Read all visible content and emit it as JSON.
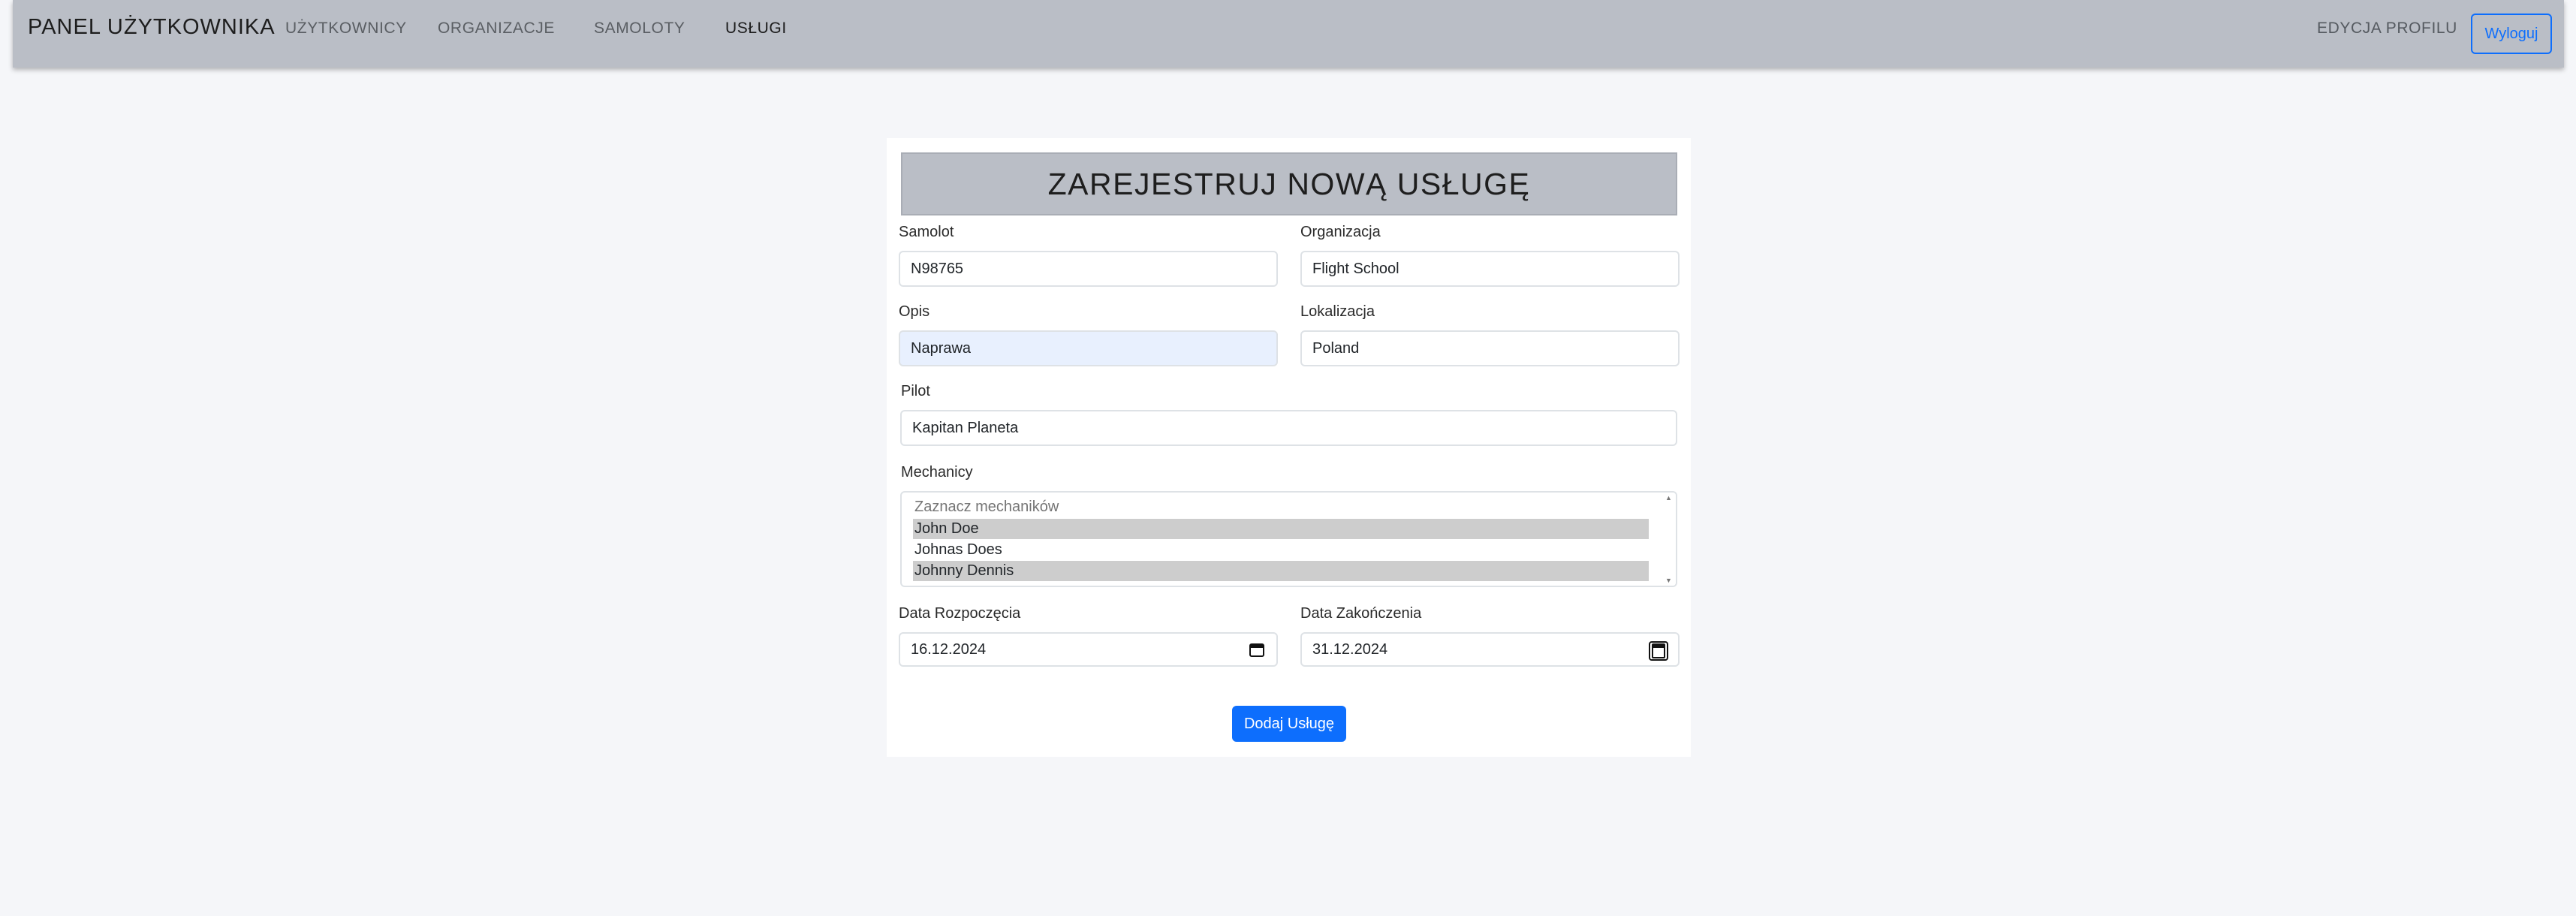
{
  "navbar": {
    "brand": "PANEL UŻYTKOWNIKA",
    "links": [
      "UŻYTKOWNICY",
      "ORGANIZACJE",
      "SAMOLOTY",
      "USŁUGI"
    ],
    "profile": "EDYCJA PROFILU",
    "logout": "Wyloguj"
  },
  "form": {
    "title": "ZAREJESTRUJ NOWĄ USŁUGĘ",
    "samolot": {
      "label": "Samolot",
      "value": "N98765"
    },
    "organizacja": {
      "label": "Organizacja",
      "value": "Flight School"
    },
    "opis": {
      "label": "Opis",
      "value": "Naprawa"
    },
    "lokalizacja": {
      "label": "Lokalizacja",
      "value": "Poland"
    },
    "pilot": {
      "label": "Pilot",
      "value": "Kapitan Planeta"
    },
    "mechanicy": {
      "label": "Mechanicy",
      "placeholder": "Zaznacz mechaników",
      "options": [
        {
          "name": "John Doe",
          "selected": true
        },
        {
          "name": "Johnas Does",
          "selected": false
        },
        {
          "name": "Johnny Dennis",
          "selected": true
        }
      ]
    },
    "data_rozpoczecia": {
      "label": "Data Rozpoczęcia",
      "value": "16.12.2024"
    },
    "data_zakonczenia": {
      "label": "Data Zakończenia",
      "value": "31.12.2024"
    },
    "submit": "Dodaj Usługę"
  },
  "colors": {
    "navbar": "#babec6",
    "accent": "#0d6efd",
    "page_bg": "#f5f6f9",
    "autofill_bg": "#e8f0fe",
    "selected_option": "#cdcdcd"
  }
}
